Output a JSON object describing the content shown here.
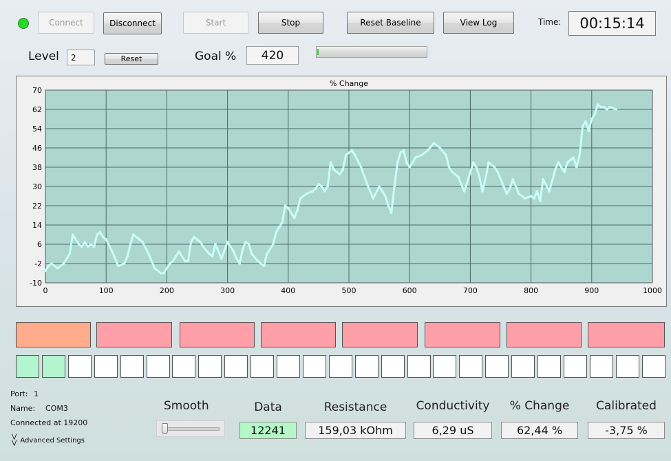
{
  "toolbar": {
    "connect_label": "Connect",
    "disconnect_label": "Disconnect",
    "start_label": "Start",
    "stop_label": "Stop",
    "reset_baseline_label": "Reset Baseline",
    "view_log_label": "View Log",
    "time_label": "Time:",
    "time_value": "00:15:14",
    "status_color": "#22dd22"
  },
  "level": {
    "label": "Level",
    "value": "2",
    "reset_label": "Reset",
    "goal_label": "Goal %",
    "goal_value": "420",
    "progress": 0
  },
  "colors": {
    "plot_bg": "#add6ce",
    "series": "#c8fff6",
    "gridline": "#4c6a66",
    "strip_orange": "#ffac8c",
    "strip_pink": "#ff9fa8",
    "square_green": "#b3f5cf",
    "data_green": "#b5f7c6"
  },
  "chart_data": {
    "type": "line",
    "title": "% Change",
    "xlim": [
      0,
      1000
    ],
    "ylim": [
      -10,
      70
    ],
    "xticks": [
      0,
      100,
      200,
      300,
      400,
      500,
      600,
      700,
      800,
      900,
      1000
    ],
    "yticks": [
      -10,
      -2,
      6,
      14,
      22,
      30,
      38,
      46,
      54,
      62,
      70
    ],
    "grid": true,
    "series": [
      {
        "x": [
          0,
          5,
          10,
          20,
          30,
          40,
          45,
          50,
          55,
          60,
          65,
          70,
          75,
          80,
          85,
          90,
          95,
          100,
          110,
          120,
          130,
          135,
          140,
          145,
          150,
          155,
          160,
          170,
          180,
          190,
          195,
          200,
          205,
          210,
          215,
          220,
          230,
          235,
          240,
          245,
          250,
          255,
          260,
          270,
          275,
          280,
          290,
          300,
          310,
          315,
          320,
          325,
          330,
          335,
          340,
          350,
          360,
          365,
          370,
          375,
          380,
          385,
          390,
          395,
          400,
          410,
          415,
          420,
          425,
          430,
          440,
          445,
          450,
          455,
          460,
          465,
          470,
          475,
          480,
          485,
          490,
          495,
          500,
          505,
          510,
          520,
          530,
          540,
          550,
          555,
          560,
          565,
          570,
          575,
          580,
          585,
          590,
          595,
          600,
          610,
          620,
          630,
          640,
          650,
          660,
          665,
          670,
          675,
          680,
          690,
          700,
          705,
          710,
          715,
          720,
          725,
          730,
          740,
          745,
          750,
          755,
          760,
          765,
          770,
          780,
          790,
          800,
          805,
          810,
          815,
          820,
          830,
          840,
          845,
          850,
          855,
          860,
          865,
          870,
          875,
          880,
          885,
          890,
          895,
          900,
          905,
          910,
          915,
          920,
          925,
          930,
          940
        ],
        "y": [
          -5,
          -3,
          -2,
          -4,
          -2,
          2,
          10,
          8,
          6,
          5,
          7,
          5,
          6,
          5,
          10,
          11,
          9,
          8,
          3,
          -3,
          -2,
          1,
          6,
          10,
          9,
          8,
          7,
          2,
          -4,
          -6,
          -6,
          -4,
          -2,
          -1,
          1,
          3,
          -1,
          -1,
          7,
          9,
          8,
          7,
          5,
          2,
          1,
          6,
          0,
          7,
          3,
          0,
          -2,
          4,
          7,
          6,
          2,
          -1,
          -3,
          2,
          4,
          6,
          11,
          13,
          15,
          22,
          21,
          17,
          20,
          25,
          26,
          27,
          28,
          29,
          31,
          30,
          28,
          30,
          40,
          37,
          36,
          35,
          37,
          43,
          44,
          45,
          43,
          38,
          31,
          25,
          30,
          28,
          26,
          22,
          19,
          30,
          40,
          44,
          45,
          40,
          38,
          42,
          43,
          45,
          48,
          46,
          43,
          38,
          36,
          35,
          34,
          28,
          36,
          40,
          38,
          34,
          28,
          33,
          40,
          38,
          36,
          33,
          30,
          27,
          29,
          33,
          27,
          25,
          26,
          25,
          28,
          24,
          33,
          28,
          37,
          40,
          38,
          36,
          40,
          41,
          42,
          38,
          43,
          55,
          57,
          53,
          58,
          60,
          64,
          63,
          63,
          62,
          63,
          62
        ]
      }
    ]
  },
  "strips": [
    "orange",
    "pink",
    "pink",
    "pink",
    "pink",
    "pink",
    "pink",
    "pink"
  ],
  "squares": [
    true,
    true,
    false,
    false,
    false,
    false,
    false,
    false,
    false,
    false,
    false,
    false,
    false,
    false,
    false,
    false,
    false,
    false,
    false,
    false,
    false,
    false,
    false,
    false,
    false
  ],
  "info": {
    "port_label": "Port:",
    "port_value": "1",
    "name_label": "Name:",
    "name_value": "COM3",
    "connected_text": "Connected at 19200",
    "advanced_label": "Advanced Settings"
  },
  "readouts": {
    "smooth_label": "Smooth",
    "smooth_level": 0,
    "data_label": "Data",
    "data_value": "12241",
    "resistance_label": "Resistance",
    "resistance_value": "159,03 kOhm",
    "conductivity_label": "Conductivity",
    "conductivity_value": "6,29 uS",
    "change_label": "% Change",
    "change_value": "62,44 %",
    "calibrated_label": "Calibrated",
    "calibrated_value": "-3,75 %"
  }
}
